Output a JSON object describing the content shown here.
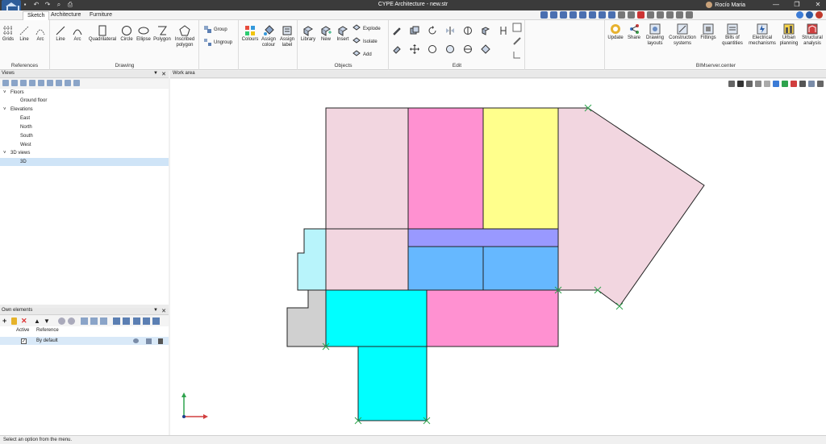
{
  "window": {
    "title": "CYPE Architecture - new.str",
    "user": "Rocío Maria",
    "minimize": "—",
    "maximize": "❐",
    "close": "✕"
  },
  "tabs": [
    "Sketch",
    "Architecture",
    "Furniture"
  ],
  "ribbon": {
    "references": {
      "label": "References",
      "buttons": [
        "Grids",
        "Line",
        "Arc"
      ]
    },
    "drawing": {
      "label": "Drawing",
      "buttons": [
        "Line",
        "Arc",
        "Quadrilateral",
        "Circle",
        "Ellipse",
        "Polygon",
        "Inscribed polygon"
      ]
    },
    "group": {
      "buttons": [
        "Group",
        "Ungroup"
      ]
    },
    "labels": {
      "buttons": [
        "Colours",
        "Assign colour",
        "Assign label"
      ]
    },
    "objects": {
      "label": "Objects",
      "buttons": [
        "Library",
        "New",
        "Insert"
      ],
      "side": [
        "Explode",
        "Isolate",
        "Add"
      ]
    },
    "edit": {
      "label": "Edit"
    },
    "bim": {
      "label": "BIMserver.center",
      "buttons": [
        "Update",
        "Share",
        "Drawing layouts",
        "Construction systems",
        "Fittings",
        "Bills of quantities",
        "Electrical mechanisms",
        "Urban planning",
        "Structural analysis"
      ]
    }
  },
  "views_panel": {
    "title": "Views",
    "tree": [
      {
        "label": "Floors",
        "level": 0,
        "expanded": true
      },
      {
        "label": "Ground floor",
        "level": 1
      },
      {
        "label": "Elevations",
        "level": 0,
        "expanded": true
      },
      {
        "label": "East",
        "level": 1
      },
      {
        "label": "North",
        "level": 1
      },
      {
        "label": "South",
        "level": 1
      },
      {
        "label": "West",
        "level": 1
      },
      {
        "label": "3D views",
        "level": 0,
        "expanded": true
      },
      {
        "label": "3D",
        "level": 1,
        "selected": true
      }
    ]
  },
  "own_elements": {
    "title": "Own elements",
    "columns": [
      "Active",
      "Reference"
    ],
    "rows": [
      {
        "active": true,
        "reference": "By default"
      }
    ]
  },
  "work_area": {
    "title": "Work area"
  },
  "colors": {
    "pink_light": "#f2d6e0",
    "magenta": "#ff91d1",
    "yellow": "#ffff8c",
    "violet": "#9999ff",
    "blue": "#66b8ff",
    "cyan": "#00ffff",
    "cyan_light": "#b8f4fb",
    "grey": "#d0d0d0"
  },
  "status": "Select an option from the menu."
}
